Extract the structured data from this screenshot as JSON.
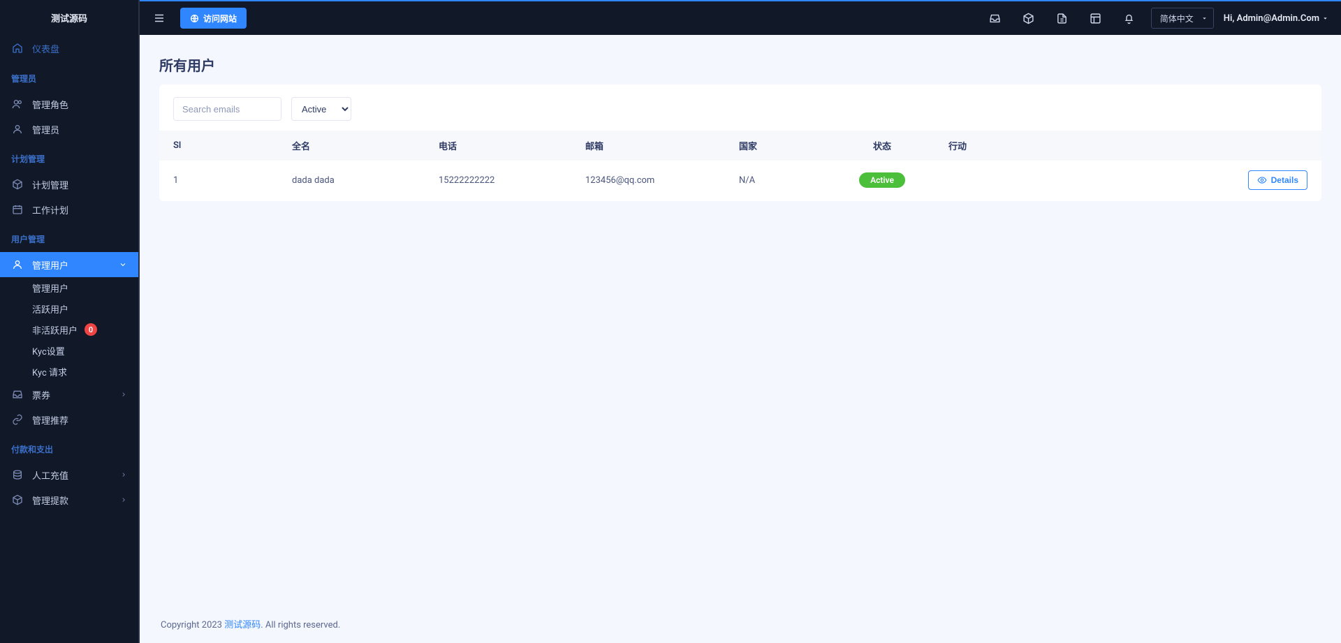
{
  "brand": "测试源码",
  "header": {
    "visit_site": "访问网站",
    "language": "简体中文",
    "user_greeting": "Hi, Admin@Admin.Com"
  },
  "sidebar": {
    "dashboard": "仪表盘",
    "sections": {
      "admin": {
        "title": "管理员",
        "items": [
          "管理角色",
          "管理员"
        ]
      },
      "plan": {
        "title": "计划管理",
        "items": [
          "计划管理",
          "工作计划"
        ]
      },
      "user": {
        "title": "用户管理",
        "items": [
          {
            "label": "管理用户",
            "expandable": true,
            "active": true,
            "children": [
              {
                "label": "管理用户"
              },
              {
                "label": "活跃用户"
              },
              {
                "label": "非活跃用户",
                "badge": "0"
              },
              {
                "label": "Kyc设置"
              },
              {
                "label": "Kyc 请求"
              }
            ]
          },
          {
            "label": "票券",
            "expandable": true
          },
          {
            "label": "管理推荐"
          }
        ]
      },
      "pay": {
        "title": "付款和支出",
        "items": [
          "人工充值",
          "管理提款"
        ]
      }
    }
  },
  "page": {
    "title": "所有用户",
    "search_placeholder": "Search emails",
    "status_filter": "Active",
    "table": {
      "headers": {
        "sl": "Sl",
        "name": "全名",
        "phone": "电话",
        "email": "邮箱",
        "country": "国家",
        "status": "状态",
        "action": "行动"
      },
      "rows": [
        {
          "sl": "1",
          "name": "dada dada",
          "phone": "15222222222",
          "email": "123456@qq.com",
          "country": "N/A",
          "status": "Active",
          "details_label": "Details"
        }
      ]
    }
  },
  "footer": {
    "prefix": "Copyright 2023 ",
    "brand": "测试源码",
    "suffix": ". All rights reserved."
  }
}
